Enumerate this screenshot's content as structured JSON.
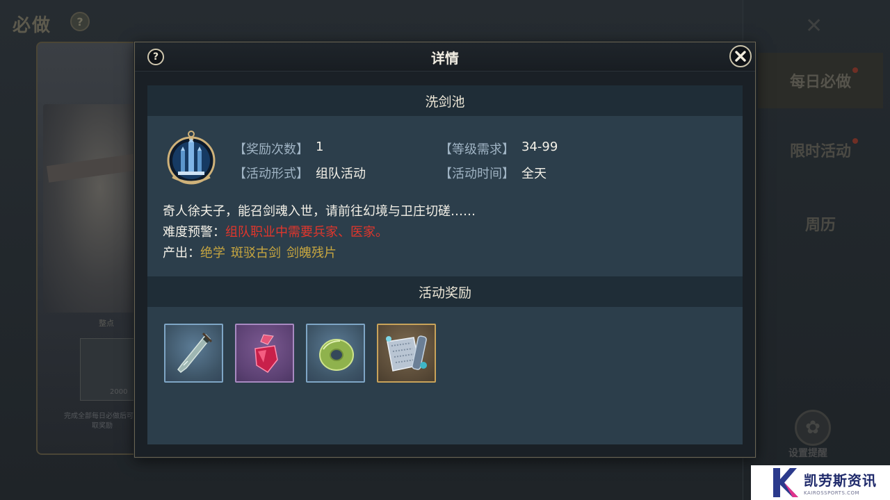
{
  "background": {
    "page_title": "必做",
    "help_glyph": "?",
    "card_label": "整点",
    "card_item_count": "2000",
    "card_desc": "完成全部每日必做后可领取奖励",
    "close_glyph": "✕",
    "side_tabs": [
      {
        "label": "每日必做"
      },
      {
        "label": "限时活动"
      },
      {
        "label": "周历"
      }
    ],
    "gear_label": "设置提醒"
  },
  "modal": {
    "title": "详情",
    "help_glyph": "?",
    "activity_name": "洗剑池",
    "info": {
      "reward_count_label": "【奖励次数】",
      "reward_count_value": "1",
      "level_req_label": "【等级需求】",
      "level_req_value": "34-99",
      "activity_form_label": "【活动形式】",
      "activity_form_value": "组队活动",
      "activity_time_label": "【活动时间】",
      "activity_time_value": "全天"
    },
    "description": "奇人徐夫子，能召剑魂入世，请前往幻境与卫庄切磋……",
    "difficulty_label": "难度预警：",
    "difficulty_value": "组队职业中需要兵家、医家。",
    "output_label": "产出：",
    "outputs": [
      "绝学",
      "斑驳古剑",
      "剑魄残片"
    ],
    "rewards_header": "活动奖励",
    "rewards": [
      {
        "icon": "sword-icon",
        "rarity": "blue"
      },
      {
        "icon": "red-crystal-icon",
        "rarity": "purple"
      },
      {
        "icon": "jade-disc-icon",
        "rarity": "blue"
      },
      {
        "icon": "scroll-bundle-icon",
        "rarity": "gold"
      }
    ]
  },
  "watermark": {
    "name": "凯劳斯资讯",
    "sub": "KAIROSSPORTS.COM"
  },
  "colors": {
    "modal_bg": "#1a2026",
    "content_bg": "#2c3e4b",
    "section_header_bg": "#1f2d37",
    "warning_red": "#e0362c",
    "output_gold": "#c7a640",
    "label_blue": "#9fb3c3"
  }
}
